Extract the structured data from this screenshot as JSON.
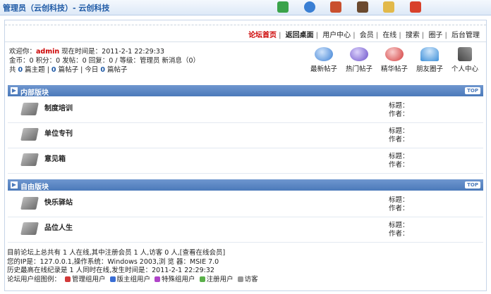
{
  "header": {
    "title": "管理员（云创科技）- 云创科技",
    "icons": [
      "exit-icon",
      "refresh-icon",
      "home-icon",
      "user-icon",
      "edit-icon",
      "power-icon"
    ]
  },
  "nav": {
    "home": "论坛首页",
    "back": "返回桌面",
    "user_center": "用户中心",
    "members": "会员",
    "online": "在线",
    "search": "搜索",
    "circles": "圈子",
    "admin": "后台管理"
  },
  "welcome": {
    "prefix": "欢迎你：",
    "user": "admin",
    "time_label": " 现在时间是：2011-2-1 22:29:33",
    "line2": "金币：0 积分：0 发帖：0 回复：0 / 等级：管理员  新消息（0）",
    "line3_a": "共 ",
    "topics": "0",
    "line3_b": " 篇主题 | ",
    "posts": "0",
    "line3_c": " 篇帖子 | 今日 ",
    "today": "0",
    "line3_d": " 篇帖子"
  },
  "quick_links": [
    {
      "label": "最新帖子",
      "icon": "new-posts-icon",
      "color": "#3a7fd4"
    },
    {
      "label": "热门帖子",
      "icon": "hot-posts-icon",
      "color": "#6a4fc9"
    },
    {
      "label": "精华帖子",
      "icon": "elite-posts-icon",
      "color": "#d23a3a"
    },
    {
      "label": "朋友圈子",
      "icon": "friends-icon",
      "color": "#3d8fd8"
    },
    {
      "label": "个人中心",
      "icon": "tools-icon",
      "color": "#555555"
    }
  ],
  "sections": [
    {
      "name": "内部版块",
      "top": "TOP",
      "forums": [
        {
          "name": "制度培训",
          "title_label": "标题：",
          "author_label": "作者："
        },
        {
          "name": "单位专刊",
          "title_label": "标题：",
          "author_label": "作者："
        },
        {
          "name": "意见箱",
          "title_label": "标题：",
          "author_label": "作者："
        }
      ]
    },
    {
      "name": "自由版块",
      "top": "TOP",
      "forums": [
        {
          "name": "快乐驿站",
          "title_label": "标题：",
          "author_label": "作者："
        },
        {
          "name": "品位人生",
          "title_label": "标题：",
          "author_label": "作者："
        }
      ]
    }
  ],
  "footer": {
    "line1": "目前论坛上总共有  1 人在线,其中注册会员  1 人,访客  0 人,[查看在线会员]",
    "line2": "您的IP是：127.0.0.1,操作系统：Windows 2003,浏 览 器：MSIE 7.0",
    "line3": "历史最高在线纪录是  1 人同时在线,发生时间是：2011-2-1 22:29:32",
    "legend_label": "论坛用户组图例：",
    "legend": [
      {
        "label": "管理组用户",
        "color": "#d23a3a"
      },
      {
        "label": "版主组用户",
        "color": "#3a6ed4"
      },
      {
        "label": "特殊组用户",
        "color": "#b044c9"
      },
      {
        "label": "注册用户",
        "color": "#5bb04a"
      },
      {
        "label": "访客",
        "color": "#999999"
      }
    ]
  }
}
